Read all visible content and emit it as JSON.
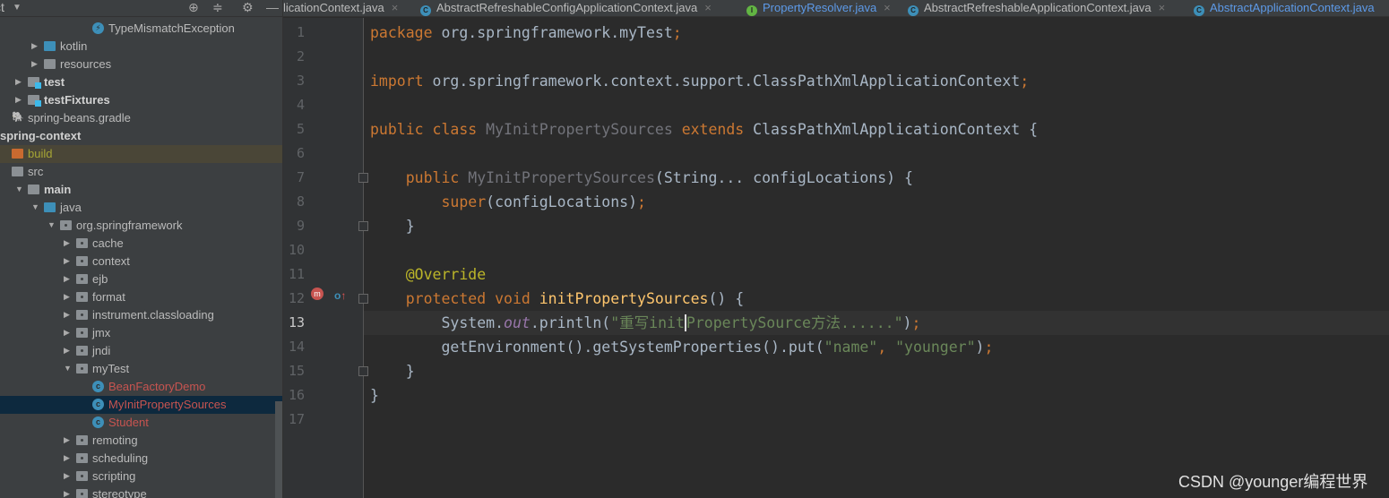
{
  "sidebar": {
    "title": "ct",
    "tree": [
      {
        "label": "TypeMismatchException",
        "type": "exception",
        "indent": 5
      },
      {
        "label": "kotlin",
        "type": "folder-blue",
        "indent": 2,
        "arrow": "right"
      },
      {
        "label": "resources",
        "type": "folder-res",
        "indent": 2,
        "arrow": "right"
      },
      {
        "label": "test",
        "type": "folder-mark",
        "indent": 1,
        "arrow": "right",
        "bold": true
      },
      {
        "label": "testFixtures",
        "type": "folder-mark",
        "indent": 1,
        "arrow": "right",
        "bold": true
      },
      {
        "label": "spring-beans.gradle",
        "type": "gradle",
        "indent": 0
      },
      {
        "label": "spring-context",
        "type": "module",
        "indent": -1,
        "bold": true
      },
      {
        "label": "build",
        "type": "folder-orange",
        "indent": 0,
        "highlight": true
      },
      {
        "label": "src",
        "type": "folder",
        "indent": 0
      },
      {
        "label": "main",
        "type": "folder",
        "indent": 1,
        "arrow": "down",
        "bold": true
      },
      {
        "label": "java",
        "type": "folder-blue",
        "indent": 2,
        "arrow": "down"
      },
      {
        "label": "org.springframework",
        "type": "package",
        "indent": 3,
        "arrow": "down"
      },
      {
        "label": "cache",
        "type": "package",
        "indent": 4,
        "arrow": "right"
      },
      {
        "label": "context",
        "type": "package",
        "indent": 4,
        "arrow": "right"
      },
      {
        "label": "ejb",
        "type": "package",
        "indent": 4,
        "arrow": "right"
      },
      {
        "label": "format",
        "type": "package",
        "indent": 4,
        "arrow": "right"
      },
      {
        "label": "instrument.classloading",
        "type": "package",
        "indent": 4,
        "arrow": "right"
      },
      {
        "label": "jmx",
        "type": "package",
        "indent": 4,
        "arrow": "right"
      },
      {
        "label": "jndi",
        "type": "package",
        "indent": 4,
        "arrow": "right"
      },
      {
        "label": "myTest",
        "type": "package",
        "indent": 4,
        "arrow": "down"
      },
      {
        "label": "BeanFactoryDemo",
        "type": "class",
        "indent": 5,
        "red": true
      },
      {
        "label": "MyInitPropertySources",
        "type": "class",
        "indent": 5,
        "red": true,
        "selected": true
      },
      {
        "label": "Student",
        "type": "class",
        "indent": 5,
        "red": true
      },
      {
        "label": "remoting",
        "type": "package",
        "indent": 4,
        "arrow": "right"
      },
      {
        "label": "scheduling",
        "type": "package",
        "indent": 4,
        "arrow": "right"
      },
      {
        "label": "scripting",
        "type": "package",
        "indent": 4,
        "arrow": "right"
      },
      {
        "label": "stereotype",
        "type": "package",
        "indent": 4,
        "arrow": "right"
      }
    ]
  },
  "tabs": [
    {
      "label": "licationContext.java",
      "icon": "",
      "blue": false
    },
    {
      "label": "AbstractRefreshableConfigApplicationContext.java",
      "icon": "C",
      "blue": false
    },
    {
      "label": "PropertyResolver.java",
      "icon": "I",
      "blue": true
    },
    {
      "label": "AbstractRefreshableApplicationContext.java",
      "icon": "C",
      "blue": false
    },
    {
      "label": "AbstractApplicationContext.java",
      "icon": "C",
      "blue": true
    }
  ],
  "editor": {
    "current_line": 13,
    "lines": [
      [
        [
          "package",
          "kw"
        ],
        [
          " org.springframework.myTest",
          ""
        ],
        [
          ";",
          "kw"
        ]
      ],
      [],
      [
        [
          "import",
          "kw"
        ],
        [
          " org.springframework.context.support.ClassPathXmlApplicationContext",
          ""
        ],
        [
          ";",
          "kw"
        ]
      ],
      [],
      [
        [
          "public class ",
          "kw"
        ],
        [
          "MyInitPropertySources ",
          "gr"
        ],
        [
          "extends ",
          "kw"
        ],
        [
          "ClassPathXmlApplicationContext {",
          ""
        ]
      ],
      [],
      [
        [
          "    public ",
          "kw"
        ],
        [
          "MyInitPropertySources",
          "gr"
        ],
        [
          "(String... configLocations) {",
          ""
        ]
      ],
      [
        [
          "        super",
          "kw"
        ],
        [
          "(configLocations)",
          ""
        ],
        [
          ";",
          "kw"
        ]
      ],
      [
        [
          "    }",
          ""
        ]
      ],
      [],
      [
        [
          "    @Override",
          "an"
        ]
      ],
      [
        [
          "    protected void ",
          "kw"
        ],
        [
          "initPropertySources",
          "fn"
        ],
        [
          "() {",
          ""
        ]
      ],
      [
        [
          "        System.",
          ""
        ],
        [
          "out",
          "it"
        ],
        [
          ".println(",
          ""
        ],
        [
          "\"重写init",
          "st"
        ],
        [
          "|",
          "caret"
        ],
        [
          "PropertySource方法......\"",
          "st"
        ],
        [
          ")",
          ""
        ],
        [
          ";",
          "kw"
        ]
      ],
      [
        [
          "        getEnvironment().getSystemProperties().put(",
          ""
        ],
        [
          "\"name\"",
          "st"
        ],
        [
          ", ",
          "kw"
        ],
        [
          "\"younger\"",
          "st"
        ],
        [
          ")",
          ""
        ],
        [
          ";",
          "kw"
        ]
      ],
      [
        [
          "    }",
          ""
        ]
      ],
      [
        [
          "}",
          ""
        ]
      ],
      []
    ]
  },
  "watermark": "CSDN @younger编程世界"
}
